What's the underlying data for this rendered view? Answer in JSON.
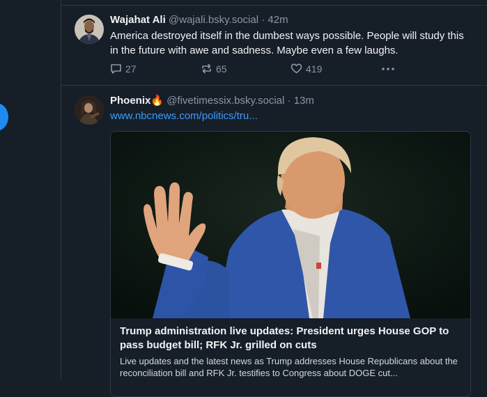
{
  "posts": [
    {
      "display_name": "Wajahat Ali",
      "handle": "@wajali.bsky.social",
      "separator": "·",
      "time": "42m",
      "text": "America destroyed itself in the dumbest ways possible. People will study this in the future with awe and sadness. Maybe even a few laughs.",
      "replies": "27",
      "reposts": "65",
      "likes": "419",
      "avatar_icon": "user-avatar"
    },
    {
      "display_name": "Phoenix🔥",
      "handle": "@fivetimessix.bsky.social",
      "separator": "·",
      "time": "13m",
      "link": "www.nbcnews.com/politics/tru...",
      "avatar_icon": "user-avatar",
      "embed": {
        "title": "Trump administration live updates: President urges House GOP to pass budget bill; RFK Jr. grilled on cuts",
        "description": "Live updates and the latest news as Trump addresses House Republicans about the reconciliation bill and RFK Jr. testifies to Congress about DOGE cut..."
      }
    }
  ],
  "colors": {
    "background": "#161e27",
    "border": "#2e3a48",
    "muted": "#8b98a8",
    "link": "#3b9dff",
    "accent": "#1d8bf2"
  }
}
